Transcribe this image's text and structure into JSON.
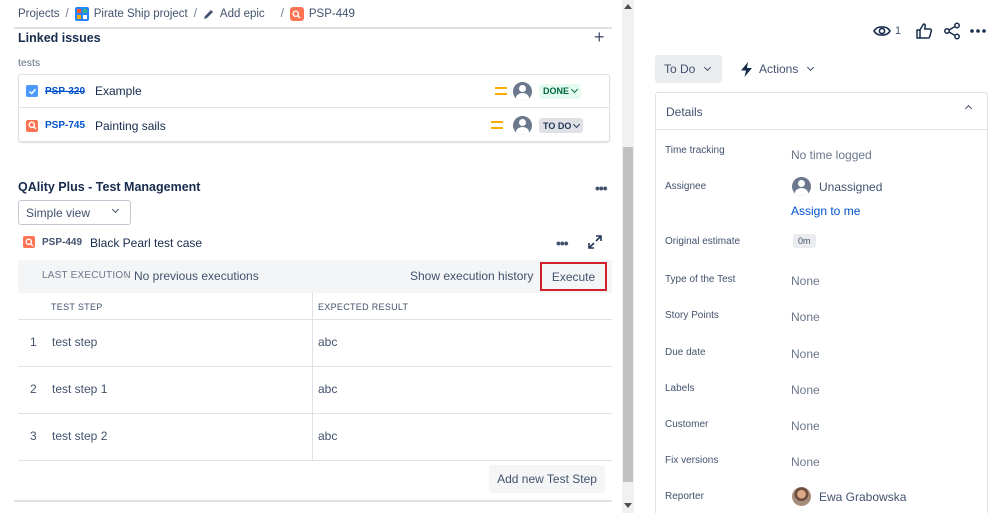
{
  "breadcrumb": {
    "projects": "Projects",
    "project": "Pirate Ship project",
    "add_epic": "Add epic",
    "issue_key": "PSP-449",
    "separator": "/"
  },
  "linked_issues": {
    "title": "Linked issues",
    "add_icon": "plus-icon",
    "relation": "tests",
    "items": [
      {
        "type_icon": "checkbox-icon",
        "type_color": "#4c9aff",
        "key": "PSP-320",
        "summary": "Example",
        "status": "DONE",
        "status_color": "#006644"
      },
      {
        "type_icon": "search-icon",
        "type_color": "#ff7452",
        "key": "PSP-745",
        "summary": "Painting sails",
        "status": "TO DO",
        "status_color": "#253858"
      }
    ],
    "priority_color": "#ffab00"
  },
  "qality": {
    "title": "QAlity Plus - Test Management",
    "view_select": "Simple view",
    "test_case_key": "PSP-449",
    "test_case_name": "Black Pearl test case",
    "last_execution_label": "LAST EXECUTION",
    "last_execution_value": "No previous executions",
    "show_history": "Show execution history",
    "execute": "Execute",
    "execute_highlight_color": "#d0202a",
    "col_step": "TEST STEP",
    "col_result": "EXPECTED RESULT",
    "steps": [
      {
        "num": "1",
        "step": "test step",
        "result": "abc"
      },
      {
        "num": "2",
        "step": "test step 1",
        "result": "abc"
      },
      {
        "num": "3",
        "step": "test step 2",
        "result": "abc"
      }
    ],
    "add_step": "Add new Test Step"
  },
  "toolbar": {
    "watchers": "1",
    "watch_icon": "eye-icon",
    "like_icon": "thumbs-up-icon",
    "share_icon": "share-icon",
    "more_icon": "more-icon"
  },
  "status_button": "To Do",
  "actions_button": "Actions",
  "details": {
    "title": "Details",
    "fields": {
      "time_tracking": {
        "label": "Time tracking",
        "value": "No time logged"
      },
      "assignee": {
        "label": "Assignee",
        "value": "Unassigned",
        "link": "Assign to me"
      },
      "original_estimate": {
        "label": "Original estimate",
        "value": "0m"
      },
      "type_of_test": {
        "label": "Type of the Test",
        "value": "None"
      },
      "story_points": {
        "label": "Story Points",
        "value": "None"
      },
      "due_date": {
        "label": "Due date",
        "value": "None"
      },
      "labels": {
        "label": "Labels",
        "value": "None"
      },
      "customer": {
        "label": "Customer",
        "value": "None"
      },
      "fix_versions": {
        "label": "Fix versions",
        "value": "None"
      },
      "reporter": {
        "label": "Reporter",
        "value": "Ewa Grabowska"
      }
    }
  },
  "accent_link_color": "#0052cc"
}
